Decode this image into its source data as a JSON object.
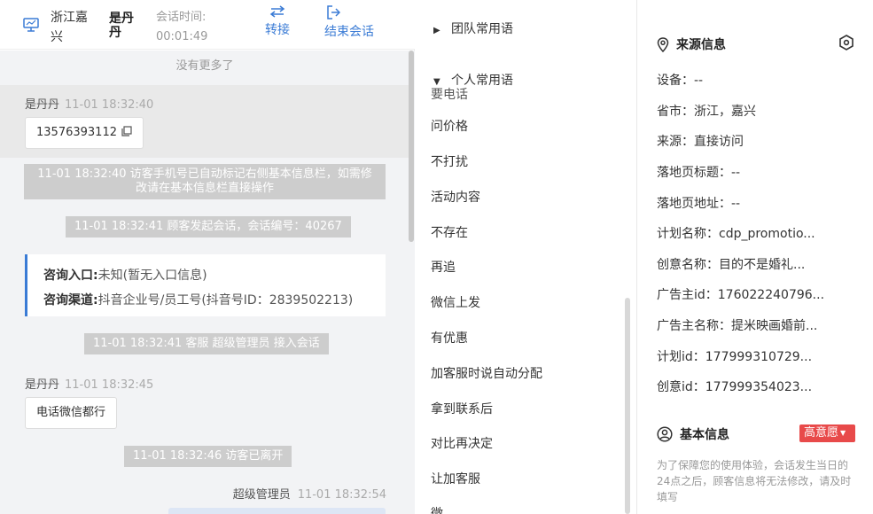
{
  "header": {
    "location": "浙江嘉兴",
    "visitor_name": "是丹丹",
    "session_time_label": "会话时间:",
    "session_time_value": "00:01:49",
    "transfer_label": "转接",
    "end_session_label": "结束会话"
  },
  "chat": {
    "no_more": "没有更多了",
    "visitor_sender": "是丹丹",
    "msg1_time": "11-01 18:32:40",
    "msg1_text": "13576393112",
    "sys_phone_line1": "11-01 18:32:40 访客手机号已自动标记右侧基本信息栏，如需修",
    "sys_phone_line2": "改请在基本信息栏直接操作",
    "sys_session_start": "11-01 18:32:41 顾客发起会话，会话编号：40267",
    "card_entry_key": "咨询入口:",
    "card_entry_value": "未知(暂无入口信息)",
    "card_channel_key": "咨询渠道:",
    "card_channel_value": "抖音企业号/员工号(抖音号ID：2839502213)",
    "sys_agent_join": "11-01 18:32:41 客服 超级管理员 接入会话",
    "msg2_time": "11-01 18:32:45",
    "msg2_text": "电话微信都行",
    "sys_visitor_left": "11-01 18:32:46 访客已离开",
    "agent_name": "超级管理员",
    "agent_time": "11-01 18:32:54"
  },
  "phrases": {
    "team_group": "团队常用语",
    "personal_group": "个人常用语",
    "partial_top": "要电话",
    "items": [
      "问价格",
      "不打扰",
      "活动内容",
      "不存在",
      "再追",
      "微信上发",
      "有优惠",
      "加客服时说自动分配",
      "拿到联系后",
      "对比再决定",
      "让加客服",
      "微"
    ]
  },
  "info": {
    "source_title": "来源信息",
    "device": "设备：--",
    "province": "省市：浙江，嘉兴",
    "source": "来源：直接访问",
    "landing_title": "落地页标题：--",
    "landing_url": "落地页地址：--",
    "plan_name": "计划名称：cdp_promotio...",
    "creative_name": "创意名称：目的不是婚礼...",
    "advertiser_id": "广告主id：176022240796...",
    "advertiser_name": "广告主名称：提米映画婚前...",
    "plan_id": "计划id：177999310729...",
    "creative_id": "创意id：177999354023...",
    "basic_title": "基本信息",
    "intent_badge": "高意愿",
    "hint": "为了保障您的使用体验，会话发生当日的24点之后，顾客信息将无法修改，请及时填写"
  },
  "colors": {
    "accent": "#3a7bd5",
    "badge_red": "#e84a4a",
    "system_msg_bg": "#cdcdcd"
  }
}
